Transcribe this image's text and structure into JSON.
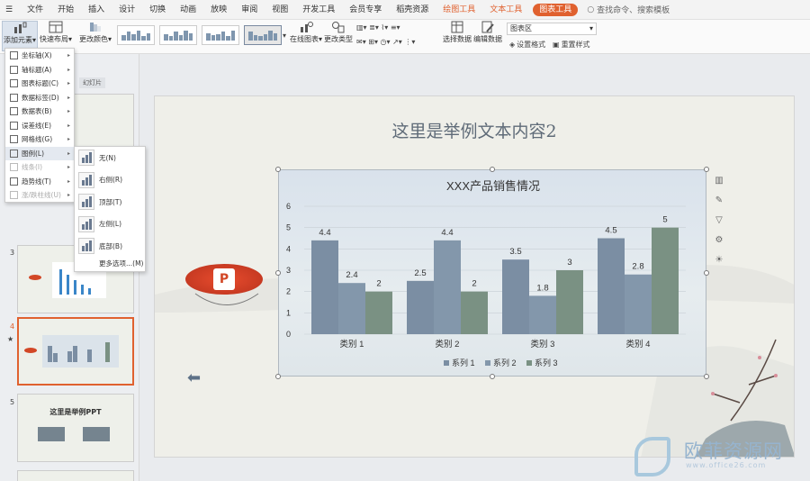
{
  "menubar": {
    "tabs": [
      "文件",
      "开始",
      "插入",
      "设计",
      "切换",
      "动画",
      "放映",
      "审阅",
      "视图",
      "开发工具",
      "会员专享",
      "稻壳资源"
    ],
    "context_tabs": [
      "绘图工具",
      "文本工具",
      "图表工具"
    ],
    "search_placeholder": "查找命令、搜索模板"
  },
  "ribbon": {
    "add_element": "添加元素",
    "quick_layout": "快速布局",
    "change_color": "更改颜色",
    "online_chart": "在线图表",
    "change_type": "更改类型",
    "select_data": "选择数据",
    "edit_data": "编辑数据",
    "chart_area": "图表区",
    "set_format": "设置格式",
    "reset_style": "重置样式"
  },
  "thumbs": {
    "numbers": [
      "3",
      "4",
      "5"
    ],
    "label_tag": "幻灯片",
    "slide5_title": "这里是举例PPT"
  },
  "element_menu": {
    "items": [
      {
        "label": "坐标轴(X)",
        "arrow": true,
        "disabled": false
      },
      {
        "label": "轴标题(A)",
        "arrow": true,
        "disabled": false
      },
      {
        "label": "图表标题(C)",
        "arrow": true,
        "disabled": false
      },
      {
        "label": "数据标签(D)",
        "arrow": true,
        "disabled": false
      },
      {
        "label": "数据表(B)",
        "arrow": true,
        "disabled": false
      },
      {
        "label": "误差线(E)",
        "arrow": true,
        "disabled": false
      },
      {
        "label": "网格线(G)",
        "arrow": true,
        "disabled": false
      },
      {
        "label": "图例(L)",
        "arrow": true,
        "disabled": false
      },
      {
        "label": "线条(I)",
        "arrow": true,
        "disabled": true
      },
      {
        "label": "趋势线(T)",
        "arrow": true,
        "disabled": false
      },
      {
        "label": "涨/跌柱线(U)",
        "arrow": true,
        "disabled": true
      }
    ]
  },
  "legend_menu": {
    "items": [
      "无(N)",
      "右侧(R)",
      "顶部(T)",
      "左侧(L)",
      "底部(B)"
    ],
    "more": "更多选项...(M)"
  },
  "slide": {
    "title": "这里是举例文本内容2",
    "logo_letter": "P"
  },
  "chart_data": {
    "type": "bar",
    "title": "XXX产品销售情况",
    "categories": [
      "类别 1",
      "类别 2",
      "类别 3",
      "类别 4"
    ],
    "series": [
      {
        "name": "系列 1",
        "values": [
          4.4,
          2.5,
          3.5,
          4.5
        ],
        "color": "#7b8ea3"
      },
      {
        "name": "系列 2",
        "values": [
          2.4,
          4.4,
          1.8,
          2.8
        ],
        "color": "#8397ab"
      },
      {
        "name": "系列 3",
        "values": [
          2,
          2,
          3,
          5
        ],
        "color": "#7a9183"
      }
    ],
    "yticks": [
      "0",
      "1",
      "2",
      "3",
      "4",
      "5",
      "6"
    ],
    "ylim": [
      0,
      6
    ],
    "legend_position": "bottom",
    "grid": true
  },
  "watermark": {
    "text": "欧菲资源网",
    "url": "www.office26.com"
  }
}
